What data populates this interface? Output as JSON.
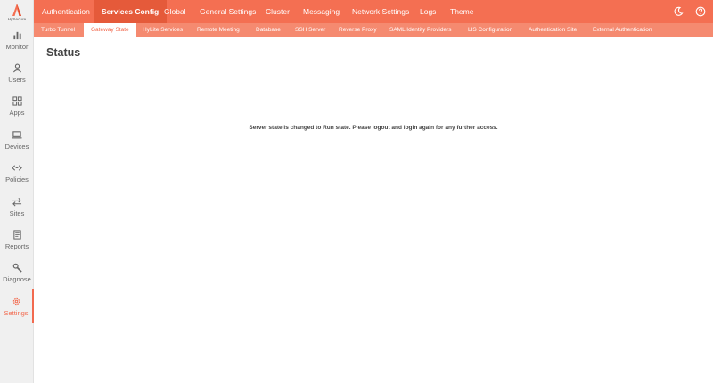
{
  "brand": {
    "name": "HySecure",
    "accent": "#f46f52"
  },
  "sidebar": {
    "items": [
      {
        "label": "Monitor",
        "icon": "bar-chart-icon"
      },
      {
        "label": "Users",
        "icon": "user-icon"
      },
      {
        "label": "Apps",
        "icon": "apps-grid-icon"
      },
      {
        "label": "Devices",
        "icon": "laptop-icon"
      },
      {
        "label": "Policies",
        "icon": "code-arrows-icon"
      },
      {
        "label": "Sites",
        "icon": "swap-arrows-icon"
      },
      {
        "label": "Reports",
        "icon": "document-icon"
      },
      {
        "label": "Diagnose",
        "icon": "wrench-icon"
      },
      {
        "label": "Settings",
        "icon": "gear-icon",
        "active": true
      }
    ]
  },
  "topnav": {
    "tabs": [
      {
        "label": "Authentication"
      },
      {
        "label": "Services Config",
        "active": true
      },
      {
        "label": "Global"
      },
      {
        "label": "General Settings"
      },
      {
        "label": "Cluster"
      },
      {
        "label": "Messaging"
      },
      {
        "label": "Network Settings"
      },
      {
        "label": "Logs"
      },
      {
        "label": "Theme"
      }
    ],
    "icons": [
      "moon-icon",
      "help-icon"
    ]
  },
  "subnav": {
    "tabs": [
      {
        "label": "Turbo Tunnel"
      },
      {
        "label": "Gateway State",
        "active": true
      },
      {
        "label": "HyLite Services"
      },
      {
        "label": "Remote Meeting"
      },
      {
        "label": "Database"
      },
      {
        "label": "SSH Server"
      },
      {
        "label": "Reverse Proxy"
      },
      {
        "label": "SAML Identity Providers"
      },
      {
        "label": "LIS Configuration"
      },
      {
        "label": "Authentication Site"
      },
      {
        "label": "External Authentication"
      }
    ]
  },
  "main": {
    "title": "Status",
    "message": "Server state is changed to Run state. Please logout and login again for any further access."
  }
}
